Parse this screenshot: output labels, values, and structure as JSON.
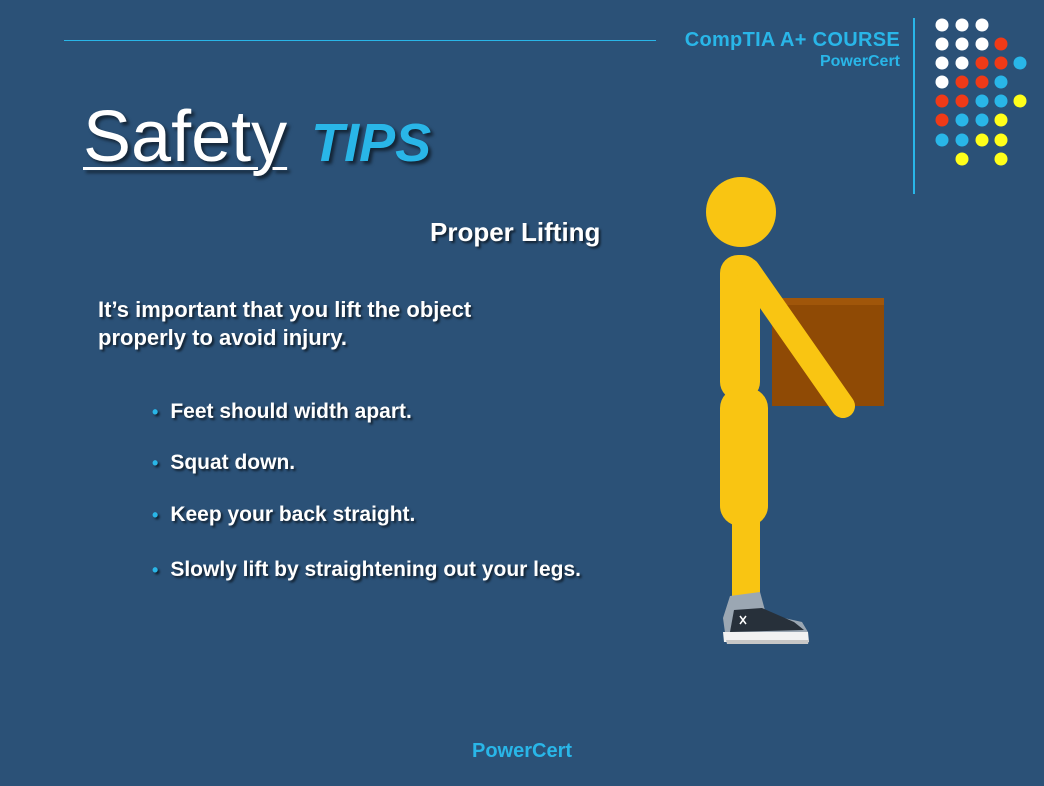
{
  "header": {
    "course_title": "CompTIA A+ COURSE",
    "brand": "PowerCert"
  },
  "title": {
    "main": "Safety",
    "accent": "TIPS"
  },
  "content": {
    "subtitle": "Proper Lifting",
    "intro": "It’s important that you lift the object properly to avoid injury.",
    "bullets": [
      "Feet should width apart.",
      "Squat down.",
      "Keep your back straight.",
      "Slowly lift by straightening out your legs."
    ]
  },
  "footer": {
    "brand": "PowerCert"
  },
  "colors": {
    "background": "#2b5177",
    "accent_blue": "#29b6e8",
    "figure_yellow": "#f9c512",
    "box_brown": "#8f4a05",
    "dot_white": "#ffffff",
    "dot_red": "#f03a17",
    "dot_yellow": "#ffff1a"
  },
  "icons": {
    "decorative_dots": "dot-grid-icon",
    "lifting_figure": "stick-figure-lifting-box-icon",
    "shoe": "sneaker-icon"
  }
}
